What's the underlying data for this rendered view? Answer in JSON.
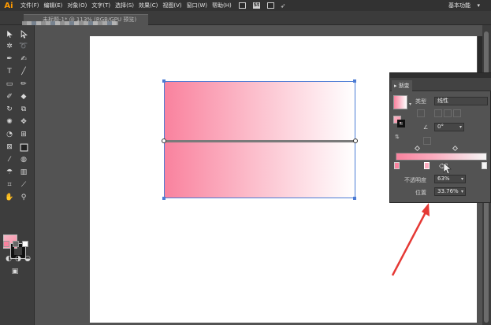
{
  "app": {
    "logo": "Ai"
  },
  "menu": {
    "items": [
      "文件(F)",
      "编辑(E)",
      "对象(O)",
      "文字(T)",
      "选择(S)",
      "效果(C)",
      "视图(V)",
      "窗口(W)",
      "帮助(H)"
    ],
    "workspace": "基本功能",
    "workspace_caret": "▾"
  },
  "document": {
    "tab_title": "未标题-1* @ 113% (RGB/GPU 预览)"
  },
  "gradient_panel": {
    "tab_label": "渐变",
    "type_label": "类型",
    "type_value": "线性",
    "angle_value": "0°",
    "opacity_label": "不透明度",
    "opacity_value": "63%",
    "location_label": "位置",
    "location_value": "33.76%"
  },
  "colors": {
    "accent_pink": "#f9829e",
    "light_pink": "#fcc2cf",
    "selection_blue": "#4c7bd4",
    "annotation_red": "#e53935"
  }
}
